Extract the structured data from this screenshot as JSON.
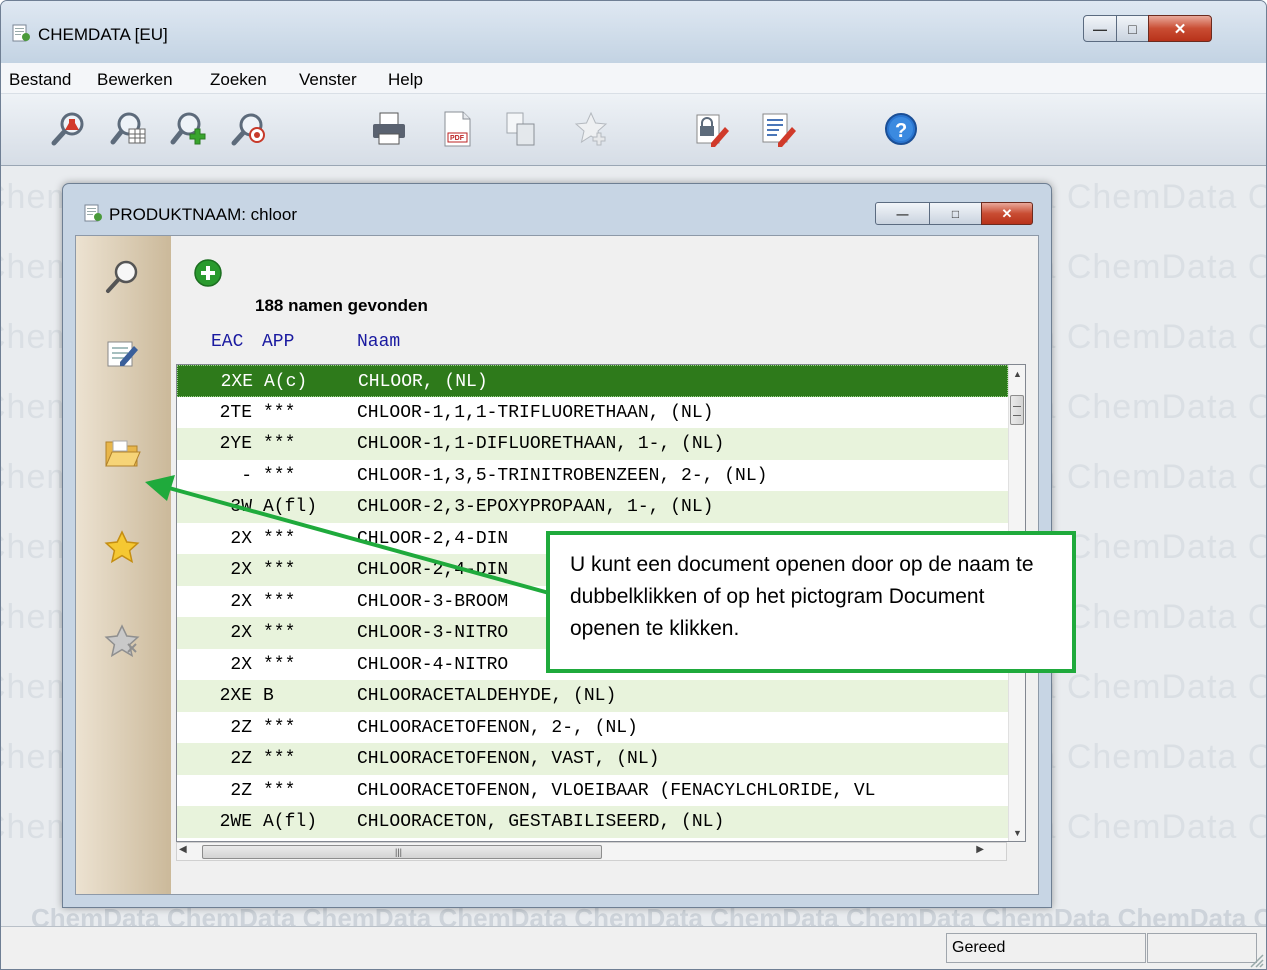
{
  "window": {
    "title": "CHEMDATA  [EU]"
  },
  "menu": [
    "Bestand",
    "Bewerken",
    "Zoeken",
    "Venster",
    "Help"
  ],
  "toolbar_icons": [
    "search-chemical-icon",
    "search-table-icon",
    "search-add-icon",
    "search-target-icon",
    "print-icon",
    "pdf-icon",
    "copy-icon",
    "favorite-add-icon",
    "security-edit-icon",
    "notes-edit-icon",
    "help-icon"
  ],
  "watermark": {
    "text": "ChemData"
  },
  "child_window": {
    "title": "PRODUKTNAAM: chloor",
    "found_text": "188 namen gevonden",
    "headers": {
      "eac": "EAC",
      "app": "APP",
      "name": "Naam"
    },
    "side_icons": [
      "search-icon",
      "edit-note-icon",
      "folder-open-icon",
      "star-icon",
      "star-gray-icon"
    ],
    "rows": [
      {
        "eac": "2XE",
        "app": "A(c)",
        "name": "CHLOOR, (NL)"
      },
      {
        "eac": "2TE",
        "app": "***",
        "name": "CHLOOR-1,1,1-TRIFLUORETHAAN, (NL)"
      },
      {
        "eac": "2YE",
        "app": "***",
        "name": "CHLOOR-1,1-DIFLUORETHAAN, 1-, (NL)"
      },
      {
        "eac": "-",
        "app": "***",
        "name": "CHLOOR-1,3,5-TRINITROBENZEEN, 2-, (NL)"
      },
      {
        "eac": "3W",
        "app": "A(fl)",
        "name": "CHLOOR-2,3-EPOXYPROPAAN, 1-, (NL)"
      },
      {
        "eac": "2X",
        "app": "***",
        "name": "CHLOOR-2,4-DIN"
      },
      {
        "eac": "2X",
        "app": "***",
        "name": "CHLOOR-2,4-DIN"
      },
      {
        "eac": "2X",
        "app": "***",
        "name": "CHLOOR-3-BROOM"
      },
      {
        "eac": "2X",
        "app": "***",
        "name": "CHLOOR-3-NITRO"
      },
      {
        "eac": "2X",
        "app": "***",
        "name": "CHLOOR-4-NITRO"
      },
      {
        "eac": "2XE",
        "app": "B",
        "name": "CHLOORACETALDEHYDE, (NL)"
      },
      {
        "eac": "2Z",
        "app": "***",
        "name": "CHLOORACETOFENON, 2-, (NL)"
      },
      {
        "eac": "2Z",
        "app": "***",
        "name": "CHLOORACETOFENON, VAST, (NL)"
      },
      {
        "eac": "2Z",
        "app": "***",
        "name": "CHLOORACETOFENON, VLOEIBAAR (FENACYLCHLORIDE, VL"
      },
      {
        "eac": "2WE",
        "app": "A(fl)",
        "name": "CHLOORACETON, GESTABILISEERD, (NL)"
      }
    ]
  },
  "callout": {
    "text": "U kunt een document openen door op de naam te dubbelklikken of op het pictogram Document openen te klikken."
  },
  "status": {
    "text": "Gereed"
  },
  "colors": {
    "selected_row": "#2e7a1b",
    "alt_row": "#e8f3dc",
    "callout_border": "#1faa3c",
    "header_text": "#1a1aa0"
  }
}
